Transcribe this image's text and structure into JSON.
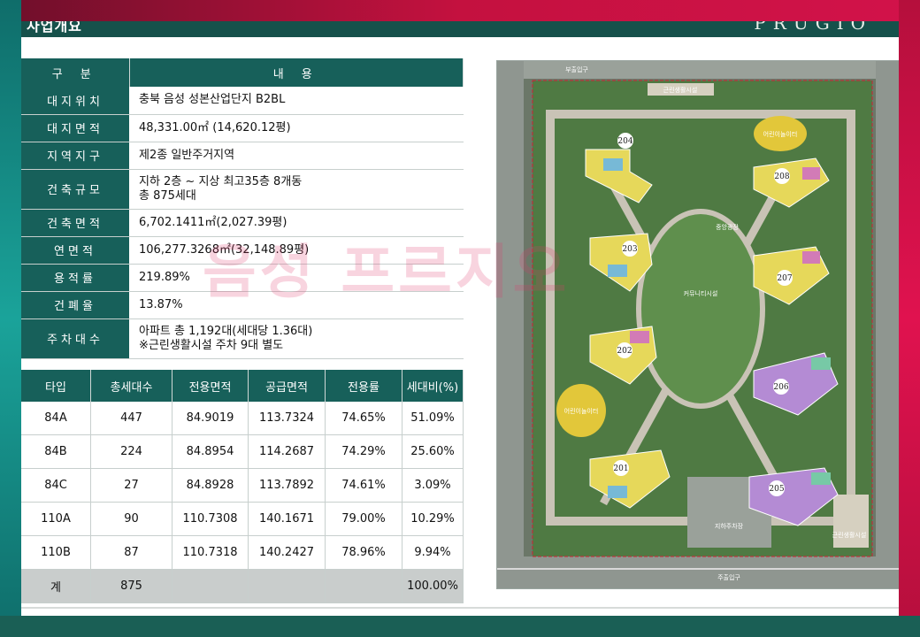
{
  "header": {
    "title": "사업개요",
    "brand": "PRUGIO"
  },
  "info_table": {
    "col_header_key": "구 분",
    "col_header_value": "내 용",
    "rows": [
      {
        "label": "대지위치",
        "value": "충북 음성 성본산업단지 B2BL"
      },
      {
        "label": "대지면적",
        "value": "48,331.00㎡ (14,620.12평)"
      },
      {
        "label": "지역지구",
        "value": "제2종 일반주거지역"
      },
      {
        "label": "건축규모",
        "value": "지하 2층 ~ 지상 최고35층 8개동",
        "value2": "총 875세대"
      },
      {
        "label": "건축면적",
        "value": "6,702.1411㎡(2,027.39평)"
      },
      {
        "label": "연면적",
        "value": "106,277.3268㎡(32,148.89평)"
      },
      {
        "label": "용적률",
        "value": "219.89%"
      },
      {
        "label": "건폐율",
        "value": "13.87%"
      },
      {
        "label": "주차대수",
        "value": "아파트 총 1,192대(세대당 1.36대)",
        "value2": "※근린생활시설 주차 9대 별도"
      }
    ]
  },
  "unit_table": {
    "headers": [
      "타입",
      "총세대수",
      "전용면적",
      "공급면적",
      "전용률",
      "세대비(%)"
    ],
    "rows": [
      [
        "84A",
        "447",
        "84.9019",
        "113.7324",
        "74.65%",
        "51.09%"
      ],
      [
        "84B",
        "224",
        "84.8954",
        "114.2687",
        "74.29%",
        "25.60%"
      ],
      [
        "84C",
        "27",
        "84.8928",
        "113.7892",
        "74.61%",
        "3.09%"
      ],
      [
        "110A",
        "90",
        "110.7308",
        "140.1671",
        "79.00%",
        "10.29%"
      ],
      [
        "110B",
        "87",
        "110.7318",
        "140.2427",
        "78.96%",
        "9.94%"
      ]
    ],
    "total": [
      "계",
      "875",
      "",
      "",
      "",
      "100.00%"
    ]
  },
  "site_plan": {
    "buildings": [
      "204",
      "208",
      "203",
      "207",
      "202",
      "206",
      "201",
      "205"
    ],
    "labels": {
      "main_gate": "주출입구",
      "sub_gate": "부출입구",
      "retail_top": "근린생활시설",
      "retail_bottom": "근린생활시설",
      "central_plaza": "중앙광장",
      "kids_top": "어린이놀이터",
      "kids_left": "어린이놀이터",
      "community": "커뮤니티시설",
      "parking": "지하주차장"
    }
  },
  "watermark": "음성 프르지오",
  "colors": {
    "teal": "#17605a",
    "frame_red": "#d2124a",
    "frame_teal": "#1aa39a"
  }
}
